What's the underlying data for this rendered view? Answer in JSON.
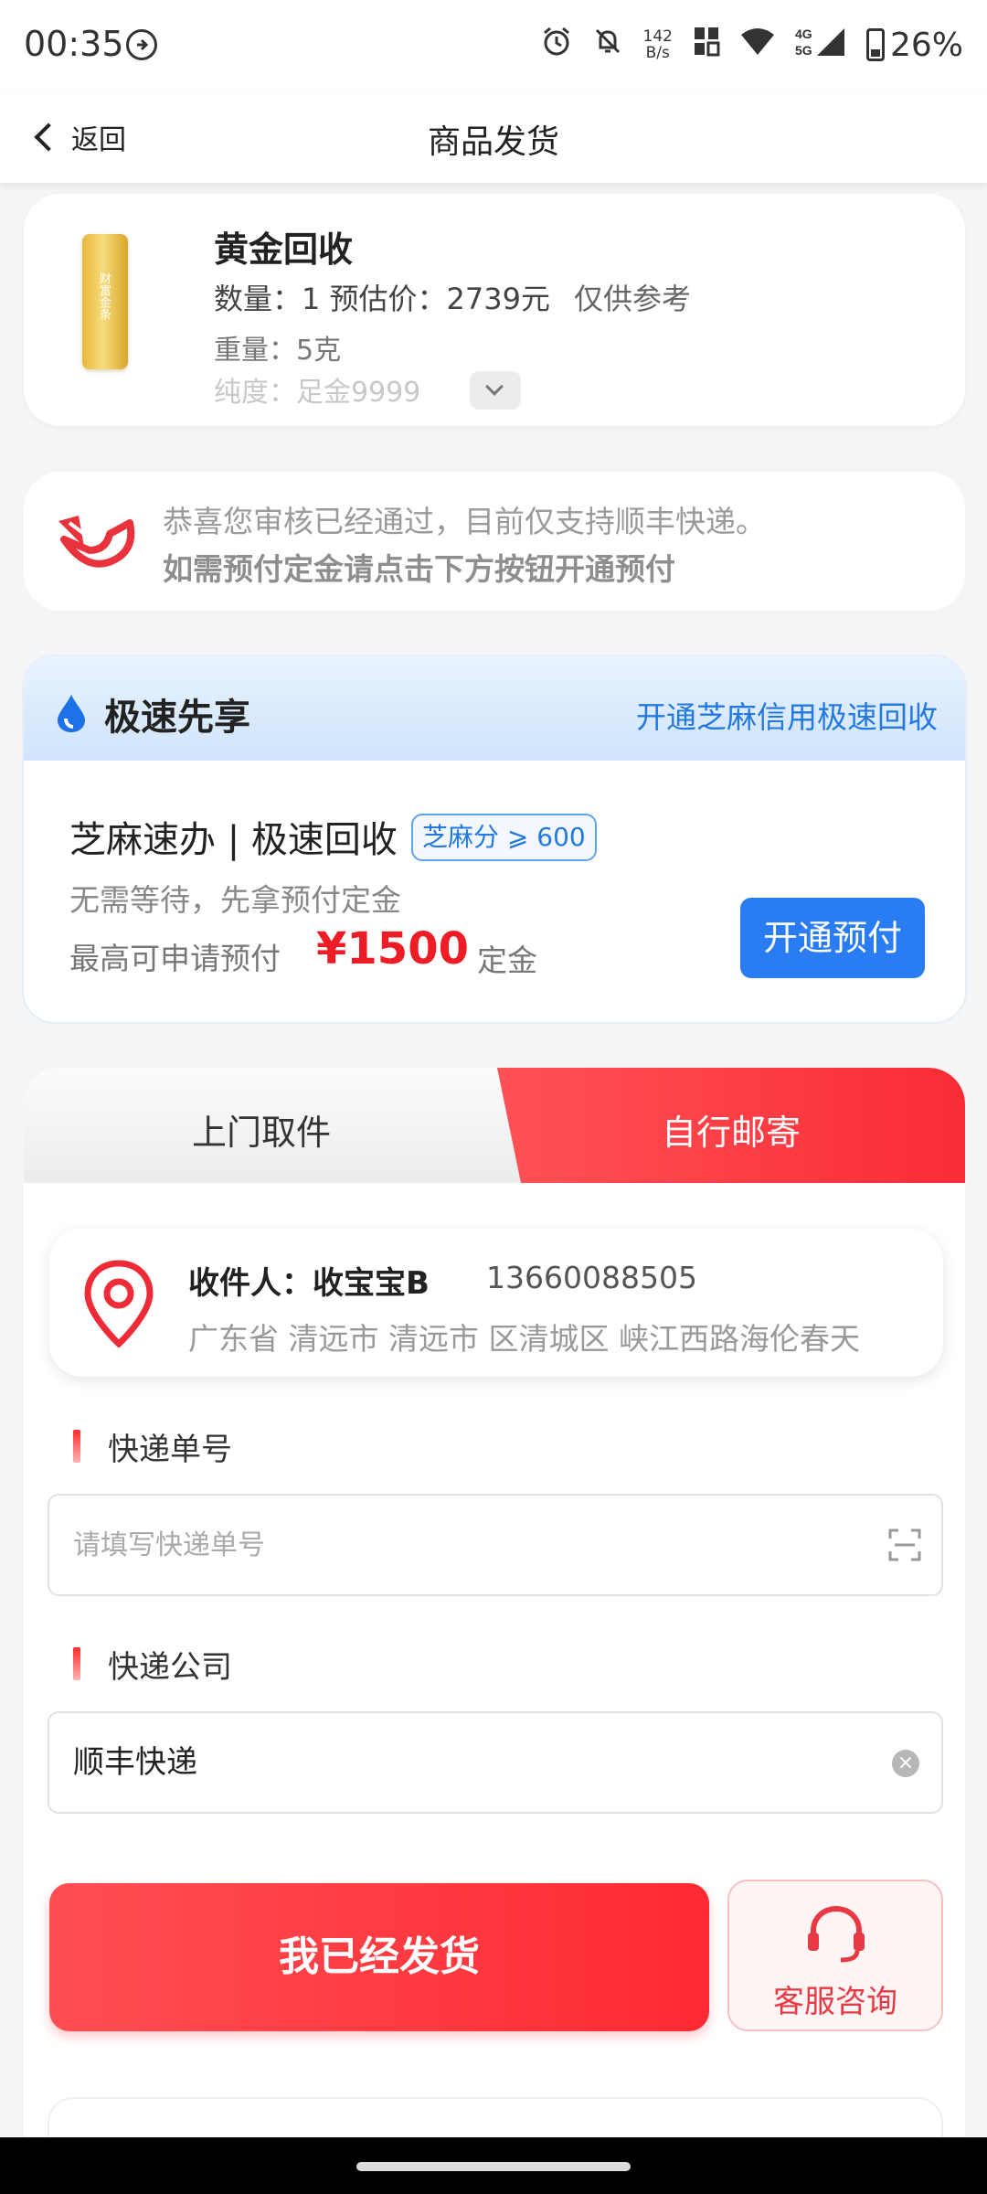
{
  "status_bar": {
    "time": "00:35",
    "net_speed_value": "142",
    "net_speed_unit": "B/s",
    "battery": "26%",
    "icons": [
      "arrow-circle-icon",
      "alarm-icon",
      "bell-off-icon",
      "nfc-icon",
      "wifi-icon",
      "signal-4g-5g-icon",
      "battery-icon"
    ]
  },
  "nav": {
    "back_label": "返回",
    "title": "商品发货"
  },
  "product": {
    "title": "黄金回收",
    "qty_line": "数量：1  预估价：2739元",
    "reference": "仅供参考",
    "weight": "重量：5克",
    "purity": "纯度：足金9999",
    "bar_text": "财富金条"
  },
  "notice": {
    "line1": "恭喜您审核已经通过，目前仅支持顺丰快递。",
    "line2": "如需预付定金请点击下方按钮开通预付"
  },
  "express": {
    "title": "极速先享",
    "link": "开通芝麻信用极速回收",
    "subtitle": "芝麻速办 | 极速回收",
    "badge": "芝麻分 ⩾ 600",
    "desc": "无需等待，先拿预付定金",
    "max_label": "最高可申请预付",
    "amount": "¥1500",
    "unit": "定金",
    "button": "开通预付",
    "accent": "#2479e0"
  },
  "shipping": {
    "tabs": [
      {
        "label": "上门取件",
        "active": false
      },
      {
        "label": "自行邮寄",
        "active": true
      }
    ],
    "recipient": {
      "name": "收件人：收宝宝B",
      "phone": "13660088505",
      "address": "广东省 清远市 清远市 区清城区 峡江西路海伦春天"
    },
    "tracking_label": "快递单号",
    "tracking_placeholder": "请填写快递单号",
    "company_label": "快递公司",
    "company_value": "顺丰快递",
    "shipped_button": "我已经发货",
    "service_button": "客服咨询",
    "accent": "#ff2a33"
  }
}
